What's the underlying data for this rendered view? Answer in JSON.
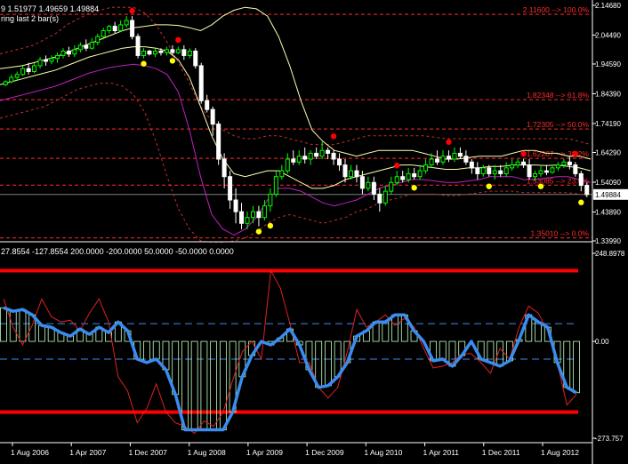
{
  "header": {
    "price_line": "9 1.51977 1.49659 1.49884",
    "sub_line": "ring last 2 bar(s)"
  },
  "colors": {
    "background": "#000000",
    "grid": "#808080",
    "candle_up": "#00ff00",
    "candle_down": "#ffffff",
    "fib": "#ff2b2b",
    "bb_upper": "#ffffb0",
    "bb_lower": "#c020c0",
    "envelope": "#c03030",
    "fractal_up": "#ff0000",
    "fractal_down": "#ffff00",
    "osc_line": "#3a8cf0",
    "osc_signal": "#e02020",
    "osc_hist": "#c0ffc0",
    "level_line": "#ff0000"
  },
  "chart_data": [
    {
      "type": "candlestick",
      "name": "price",
      "ylim": [
        1.3399,
        2.1468
      ],
      "y_ticks": [
        "2.14680",
        "2.04490",
        "1.94590",
        "1.84390",
        "1.74190",
        "1.64290",
        "1.54090",
        "1.43890",
        "1.33990"
      ],
      "current_price": "1.49884",
      "x_ticks": [
        "1 Aug 2006",
        "1 Apr 2007",
        "1 Dec 2007",
        "1 Aug 2008",
        "1 Apr 2009",
        "1 Dec 2009",
        "1 Aug 2010",
        "1 Apr 2011",
        "1 Dec 2011",
        "1 Aug 2012"
      ],
      "fib_levels": [
        {
          "price": 2.116,
          "label": "2.11600 --> 100.0%"
        },
        {
          "price": 1.8235,
          "label": "1.82348 --> 61.8%"
        },
        {
          "price": 1.7231,
          "label": "1.72305 --> 50.0%"
        },
        {
          "price": 1.6227,
          "label": "1.62267 --> 38.2%"
        },
        {
          "price": 1.5309,
          "label": "1.53085 --> 23.6%"
        },
        {
          "price": 1.3501,
          "label": "1.35010 --> 0.0%"
        }
      ],
      "candles": [
        [
          1.875,
          1.885,
          1.87,
          1.89
        ],
        [
          1.885,
          1.9,
          1.88,
          1.91
        ],
        [
          1.9,
          1.91,
          1.89,
          1.92
        ],
        [
          1.91,
          1.93,
          1.905,
          1.94
        ],
        [
          1.93,
          1.92,
          1.91,
          1.95
        ],
        [
          1.92,
          1.94,
          1.915,
          1.95
        ],
        [
          1.94,
          1.96,
          1.93,
          1.97
        ],
        [
          1.96,
          1.955,
          1.94,
          1.975
        ],
        [
          1.955,
          1.965,
          1.945,
          1.975
        ],
        [
          1.965,
          1.975,
          1.95,
          1.985
        ],
        [
          1.975,
          1.99,
          1.965,
          2.0
        ],
        [
          1.99,
          1.98,
          1.97,
          2.005
        ],
        [
          1.98,
          1.995,
          1.97,
          2.01
        ],
        [
          1.995,
          2.01,
          1.985,
          2.02
        ],
        [
          2.01,
          2.0,
          1.99,
          2.03
        ],
        [
          2.0,
          2.02,
          1.995,
          2.035
        ],
        [
          2.02,
          2.04,
          2.01,
          2.05
        ],
        [
          2.04,
          2.06,
          2.03,
          2.07
        ],
        [
          2.06,
          2.075,
          2.05,
          2.08
        ],
        [
          2.075,
          2.06,
          2.05,
          2.09
        ],
        [
          2.06,
          2.08,
          2.055,
          2.095
        ],
        [
          2.08,
          2.095,
          2.07,
          2.11
        ],
        [
          2.095,
          2.04,
          2.03,
          2.11
        ],
        [
          2.04,
          1.975,
          1.965,
          2.05
        ],
        [
          1.975,
          1.99,
          1.965,
          2.0
        ],
        [
          1.99,
          1.98,
          1.975,
          1.995
        ],
        [
          1.98,
          1.99,
          1.97,
          2.0
        ],
        [
          1.99,
          1.985,
          1.975,
          2.0
        ],
        [
          1.985,
          1.995,
          1.975,
          2.005
        ],
        [
          1.995,
          1.985,
          1.975,
          2.01
        ],
        [
          1.985,
          1.995,
          1.98,
          2.005
        ],
        [
          1.995,
          1.975,
          1.96,
          2.01
        ],
        [
          1.975,
          1.99,
          1.965,
          2.0
        ],
        [
          1.99,
          1.94,
          1.93,
          2.0
        ],
        [
          1.94,
          1.82,
          1.81,
          1.95
        ],
        [
          1.82,
          1.79,
          1.78,
          1.84
        ],
        [
          1.79,
          1.74,
          1.7,
          1.8
        ],
        [
          1.74,
          1.62,
          1.6,
          1.75
        ],
        [
          1.62,
          1.56,
          1.52,
          1.64
        ],
        [
          1.56,
          1.48,
          1.45,
          1.58
        ],
        [
          1.48,
          1.44,
          1.4,
          1.52
        ],
        [
          1.44,
          1.4,
          1.38,
          1.47
        ],
        [
          1.4,
          1.42,
          1.38,
          1.44
        ],
        [
          1.42,
          1.44,
          1.4,
          1.46
        ],
        [
          1.44,
          1.42,
          1.39,
          1.46
        ],
        [
          1.42,
          1.46,
          1.41,
          1.48
        ],
        [
          1.46,
          1.5,
          1.44,
          1.52
        ],
        [
          1.5,
          1.56,
          1.49,
          1.58
        ],
        [
          1.56,
          1.58,
          1.55,
          1.6
        ],
        [
          1.58,
          1.62,
          1.57,
          1.64
        ],
        [
          1.62,
          1.61,
          1.6,
          1.65
        ],
        [
          1.61,
          1.63,
          1.6,
          1.65
        ],
        [
          1.63,
          1.62,
          1.605,
          1.66
        ],
        [
          1.62,
          1.64,
          1.6,
          1.65
        ],
        [
          1.64,
          1.63,
          1.62,
          1.66
        ],
        [
          1.63,
          1.65,
          1.62,
          1.68
        ],
        [
          1.65,
          1.64,
          1.62,
          1.66
        ],
        [
          1.64,
          1.62,
          1.6,
          1.65
        ],
        [
          1.62,
          1.6,
          1.58,
          1.64
        ],
        [
          1.6,
          1.56,
          1.54,
          1.62
        ],
        [
          1.56,
          1.58,
          1.55,
          1.6
        ],
        [
          1.58,
          1.56,
          1.54,
          1.6
        ],
        [
          1.56,
          1.52,
          1.5,
          1.58
        ],
        [
          1.52,
          1.54,
          1.51,
          1.56
        ],
        [
          1.54,
          1.5,
          1.48,
          1.56
        ],
        [
          1.5,
          1.47,
          1.44,
          1.52
        ],
        [
          1.47,
          1.51,
          1.46,
          1.53
        ],
        [
          1.51,
          1.54,
          1.5,
          1.56
        ],
        [
          1.54,
          1.56,
          1.53,
          1.58
        ],
        [
          1.56,
          1.55,
          1.54,
          1.58
        ],
        [
          1.55,
          1.57,
          1.54,
          1.59
        ],
        [
          1.57,
          1.56,
          1.55,
          1.59
        ],
        [
          1.56,
          1.58,
          1.55,
          1.6
        ],
        [
          1.58,
          1.6,
          1.57,
          1.62
        ],
        [
          1.6,
          1.62,
          1.59,
          1.64
        ],
        [
          1.62,
          1.61,
          1.6,
          1.65
        ],
        [
          1.61,
          1.63,
          1.6,
          1.65
        ],
        [
          1.63,
          1.62,
          1.61,
          1.65
        ],
        [
          1.62,
          1.64,
          1.61,
          1.66
        ],
        [
          1.64,
          1.63,
          1.62,
          1.66
        ],
        [
          1.63,
          1.61,
          1.6,
          1.65
        ],
        [
          1.61,
          1.59,
          1.57,
          1.62
        ],
        [
          1.59,
          1.57,
          1.55,
          1.61
        ],
        [
          1.57,
          1.59,
          1.56,
          1.6
        ],
        [
          1.59,
          1.57,
          1.56,
          1.6
        ],
        [
          1.57,
          1.58,
          1.55,
          1.6
        ],
        [
          1.58,
          1.57,
          1.56,
          1.6
        ],
        [
          1.57,
          1.59,
          1.56,
          1.61
        ],
        [
          1.59,
          1.6,
          1.58,
          1.62
        ],
        [
          1.6,
          1.61,
          1.59,
          1.62
        ],
        [
          1.61,
          1.6,
          1.59,
          1.62
        ],
        [
          1.6,
          1.56,
          1.55,
          1.62
        ],
        [
          1.56,
          1.57,
          1.545,
          1.58
        ],
        [
          1.57,
          1.58,
          1.56,
          1.6
        ],
        [
          1.58,
          1.575,
          1.565,
          1.6
        ],
        [
          1.575,
          1.59,
          1.57,
          1.6
        ],
        [
          1.59,
          1.6,
          1.58,
          1.61
        ],
        [
          1.6,
          1.61,
          1.59,
          1.62
        ],
        [
          1.61,
          1.6,
          1.585,
          1.63
        ],
        [
          1.6,
          1.57,
          1.56,
          1.61
        ],
        [
          1.57,
          1.53,
          1.51,
          1.58
        ],
        [
          1.53,
          1.499,
          1.49,
          1.54
        ]
      ],
      "bb_upper": [
        1.93,
        1.935,
        1.94,
        1.95,
        1.96,
        1.97,
        1.985,
        2.0,
        2.015,
        2.03,
        2.045,
        2.06,
        2.07,
        2.075,
        2.08,
        2.08,
        2.078,
        2.07,
        2.06,
        2.08,
        2.11,
        2.13,
        2.14,
        2.135,
        2.11,
        2.04,
        1.94,
        1.82,
        1.72,
        1.68,
        1.65,
        1.64,
        1.63,
        1.64,
        1.65,
        1.65,
        1.65,
        1.65,
        1.64,
        1.63,
        1.62,
        1.62,
        1.625,
        1.63,
        1.63,
        1.63,
        1.64,
        1.65,
        1.65,
        1.64,
        1.64,
        1.63,
        1.63,
        1.62
      ],
      "bb_lower": [
        1.82,
        1.83,
        1.84,
        1.85,
        1.86,
        1.87,
        1.885,
        1.9,
        1.915,
        1.925,
        1.935,
        1.94,
        1.945,
        1.94,
        1.93,
        1.91,
        1.85,
        1.72,
        1.56,
        1.43,
        1.38,
        1.36,
        1.38,
        1.42,
        1.48,
        1.52,
        1.52,
        1.51,
        1.49,
        1.47,
        1.46,
        1.47,
        1.48,
        1.5,
        1.52,
        1.53,
        1.54,
        1.55,
        1.55,
        1.545,
        1.54,
        1.54,
        1.545,
        1.55,
        1.56,
        1.56,
        1.56,
        1.55,
        1.55,
        1.555,
        1.56,
        1.56,
        1.55,
        1.54
      ],
      "bb_mid": [
        1.875,
        1.885,
        1.895,
        1.905,
        1.915,
        1.925,
        1.94,
        1.955,
        1.97,
        1.98,
        1.99,
        2.0,
        2.005,
        2.005,
        2.0,
        1.99,
        1.96,
        1.9,
        1.8,
        1.7,
        1.62,
        1.57,
        1.56,
        1.57,
        1.58,
        1.58,
        1.56,
        1.54,
        1.52,
        1.52,
        1.53,
        1.55,
        1.56,
        1.57,
        1.58,
        1.59,
        1.6,
        1.6,
        1.595,
        1.59,
        1.585,
        1.585,
        1.59,
        1.59,
        1.595,
        1.595,
        1.6,
        1.6,
        1.6,
        1.598,
        1.6,
        1.595,
        1.59,
        1.58
      ],
      "env_upper": [
        1.98,
        1.99,
        2.0,
        2.01,
        2.03,
        2.05,
        2.08,
        2.1,
        2.12,
        2.13,
        2.14,
        2.14,
        2.14,
        2.12,
        2.08,
        2.02,
        1.95,
        1.88,
        1.8,
        1.75,
        1.72,
        1.7,
        1.69,
        1.69,
        1.7,
        1.7,
        1.69,
        1.68,
        1.67,
        1.67,
        1.67,
        1.68,
        1.69,
        1.7,
        1.7,
        1.7,
        1.7,
        1.7,
        1.7,
        1.695,
        1.69,
        1.69,
        1.69,
        1.69,
        1.69,
        1.69,
        1.69,
        1.69,
        1.69,
        1.69,
        1.69,
        1.69,
        1.68,
        1.67
      ],
      "env_lower": [
        1.76,
        1.77,
        1.78,
        1.79,
        1.8,
        1.82,
        1.84,
        1.86,
        1.87,
        1.88,
        1.88,
        1.87,
        1.84,
        1.78,
        1.68,
        1.56,
        1.45,
        1.38,
        1.34,
        1.335,
        1.335,
        1.34,
        1.35,
        1.37,
        1.4,
        1.42,
        1.43,
        1.42,
        1.41,
        1.4,
        1.41,
        1.42,
        1.44,
        1.45,
        1.47,
        1.48,
        1.49,
        1.5,
        1.5,
        1.5,
        1.495,
        1.495,
        1.5,
        1.505,
        1.51,
        1.51,
        1.51,
        1.505,
        1.505,
        1.505,
        1.505,
        1.505,
        1.5,
        1.49
      ],
      "fractals_up": [
        [
          22,
          2.11
        ],
        [
          30,
          2.01
        ],
        [
          57,
          1.68
        ],
        [
          68,
          1.58
        ],
        [
          77,
          1.66
        ],
        [
          90,
          1.62
        ],
        [
          99,
          1.62
        ]
      ],
      "fractals_down": [
        [
          24,
          1.965
        ],
        [
          29,
          1.975
        ],
        [
          44,
          1.39
        ],
        [
          46,
          1.41
        ],
        [
          71,
          1.54
        ],
        [
          84,
          1.545
        ],
        [
          93,
          1.545
        ],
        [
          100,
          1.49
        ]
      ]
    },
    {
      "type": "line",
      "name": "oscillator",
      "ylim": [
        -273.757,
        248.8978
      ],
      "y_ticks": [
        "248.8978",
        "0.00",
        "-273.757"
      ],
      "levels": {
        "label": "27.8554 -127.8554 200.0000 -200.0000 50.0000 -50.0000 0.0000",
        "red": [
          200,
          -200
        ],
        "blue": [
          50,
          -50
        ],
        "zero": 0
      },
      "osc": [
        95,
        85,
        90,
        75,
        45,
        40,
        25,
        15,
        35,
        20,
        40,
        25,
        55,
        30,
        -50,
        -60,
        -50,
        -80,
        -150,
        -250,
        -250,
        -250,
        -250,
        -250,
        -200,
        -100,
        -40,
        0,
        -10,
        10,
        35,
        -10,
        -80,
        -130,
        -125,
        -100,
        -60,
        15,
        30,
        55,
        55,
        75,
        75,
        30,
        0,
        -55,
        -50,
        -70,
        -40,
        0,
        -50,
        -60,
        -70,
        -55,
        5,
        75,
        55,
        40,
        -60,
        -130,
        -145
      ],
      "signal": [
        120,
        40,
        -10,
        45,
        120,
        70,
        55,
        60,
        30,
        80,
        120,
        55,
        -100,
        -140,
        -230,
        -190,
        -120,
        -200,
        -230,
        -240,
        -260,
        -225,
        -240,
        -200,
        -110,
        -30,
        0,
        -50,
        200,
        150,
        50,
        -60,
        -60,
        -130,
        -160,
        -130,
        -30,
        90,
        40,
        55,
        75,
        45,
        65,
        40,
        -20,
        -75,
        -70,
        -60,
        -35,
        -35,
        -60,
        -90,
        -20,
        -50,
        40,
        100,
        80,
        30,
        -60,
        -180,
        -150
      ]
    }
  ]
}
